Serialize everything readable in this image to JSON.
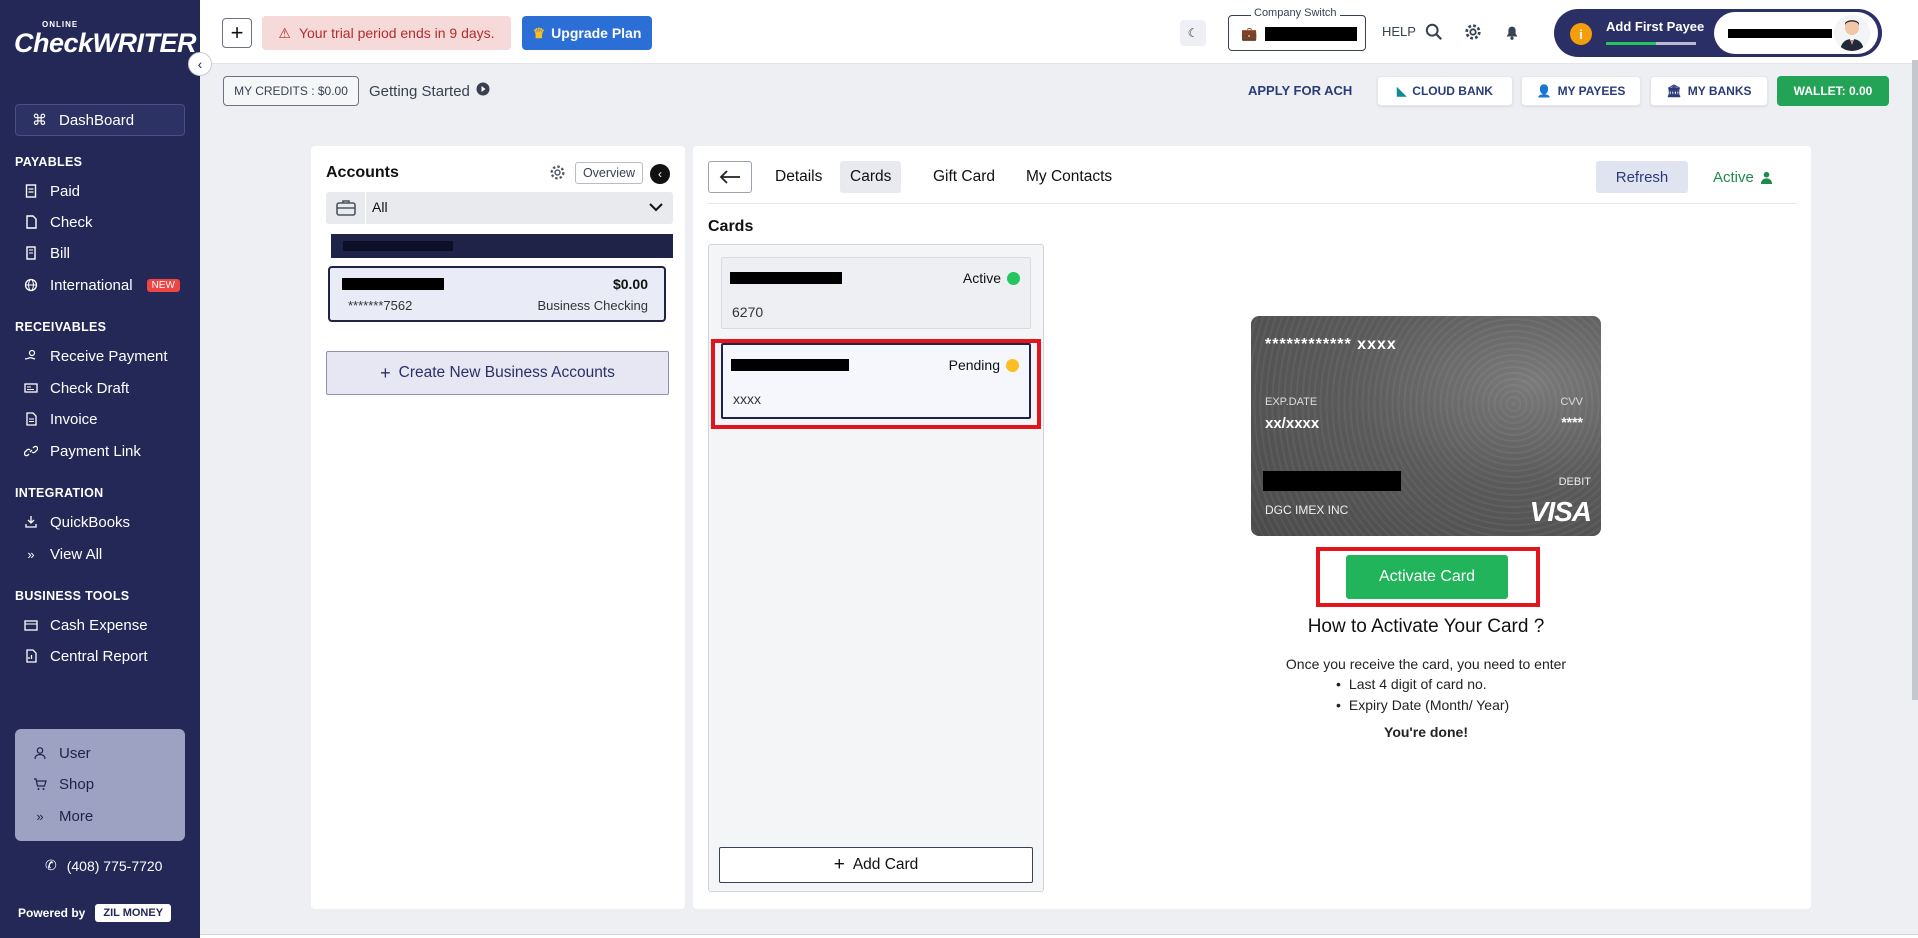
{
  "brand": {
    "logo_small": "ONLINE",
    "logo_big": "CheckWRITER"
  },
  "sidebar": {
    "dashboard": "DashBoard",
    "sections": [
      {
        "title": "PAYABLES",
        "items": [
          {
            "label": "Paid",
            "icon": "receipt-icon"
          },
          {
            "label": "Check",
            "icon": "file-icon"
          },
          {
            "label": "Bill",
            "icon": "bill-icon"
          },
          {
            "label": "International",
            "icon": "globe-icon",
            "badge": "NEW"
          }
        ]
      },
      {
        "title": "RECEIVABLES",
        "items": [
          {
            "label": "Receive Payment",
            "icon": "hand-coin-icon"
          },
          {
            "label": "Check Draft",
            "icon": "draft-icon"
          },
          {
            "label": "Invoice",
            "icon": "invoice-icon"
          },
          {
            "label": "Payment Link",
            "icon": "link-icon"
          }
        ]
      },
      {
        "title": "INTEGRATION",
        "items": [
          {
            "label": "QuickBooks",
            "icon": "import-icon"
          },
          {
            "label": "View All",
            "icon": "double-chevron-icon"
          }
        ]
      },
      {
        "title": "BUSINESS TOOLS",
        "items": [
          {
            "label": "Cash Expense",
            "icon": "wallet-icon"
          },
          {
            "label": "Central Report",
            "icon": "report-icon"
          }
        ]
      }
    ],
    "panel": [
      {
        "label": "User",
        "icon": "user-icon"
      },
      {
        "label": "Shop",
        "icon": "cart-icon"
      },
      {
        "label": "More",
        "icon": "double-chevron-icon"
      }
    ],
    "phone": "(408) 775-7720",
    "powered_by": "Powered by",
    "powered_brand": "ZIL MONEY"
  },
  "topbar": {
    "trial_text": "Your trial period ends in 9 days.",
    "upgrade_label": "Upgrade Plan",
    "company_switch_label": "Company Switch",
    "help_label": "HELP",
    "payee_label": "Add First Payee",
    "payee_progress": 0.55
  },
  "subbar": {
    "credits": "MY CREDITS : $0.00",
    "getting_started": "Getting Started",
    "apply_ach": "APPLY FOR ACH",
    "cloud_bank": "CLOUD BANK",
    "my_payees": "MY PAYEES",
    "my_banks": "MY BANKS",
    "wallet": "WALLET: 0.00"
  },
  "accounts": {
    "title": "Accounts",
    "overview": "Overview",
    "filter": "All",
    "account": {
      "amount": "$0.00",
      "number": "*******7562",
      "type": "Business Checking"
    },
    "create_label": "Create New Business Accounts"
  },
  "right": {
    "tabs": [
      "Details",
      "Cards",
      "Gift Card",
      "My Contacts"
    ],
    "active_tab": "Cards",
    "refresh": "Refresh",
    "status": "Active",
    "cards_title": "Cards",
    "cards": [
      {
        "status": "Active",
        "sub": "6270",
        "dot": "#22c55e"
      },
      {
        "status": "Pending",
        "sub": "xxxx",
        "dot": "#fbbf24"
      }
    ],
    "add_card": "Add Card"
  },
  "vcard": {
    "number": "************ xxxx",
    "exp_label": "EXP.DATE",
    "exp_value": "xx/xxxx",
    "cvv_label": "CVV",
    "cvv_value": "****",
    "type": "DEBIT",
    "holder": "DGC IMEX INC",
    "network": "VISA"
  },
  "activate": {
    "button": "Activate Card",
    "title": "How to Activate Your Card ?",
    "intro": "Once you receive the card, you need to enter",
    "steps": [
      "Last 4 digit of card no.",
      "Expiry Date (Month/ Year)"
    ],
    "done": "You're done!"
  },
  "colors": {
    "sidebar": "#232857",
    "accent_green": "#22b45a",
    "highlight_red": "#e3141b"
  }
}
